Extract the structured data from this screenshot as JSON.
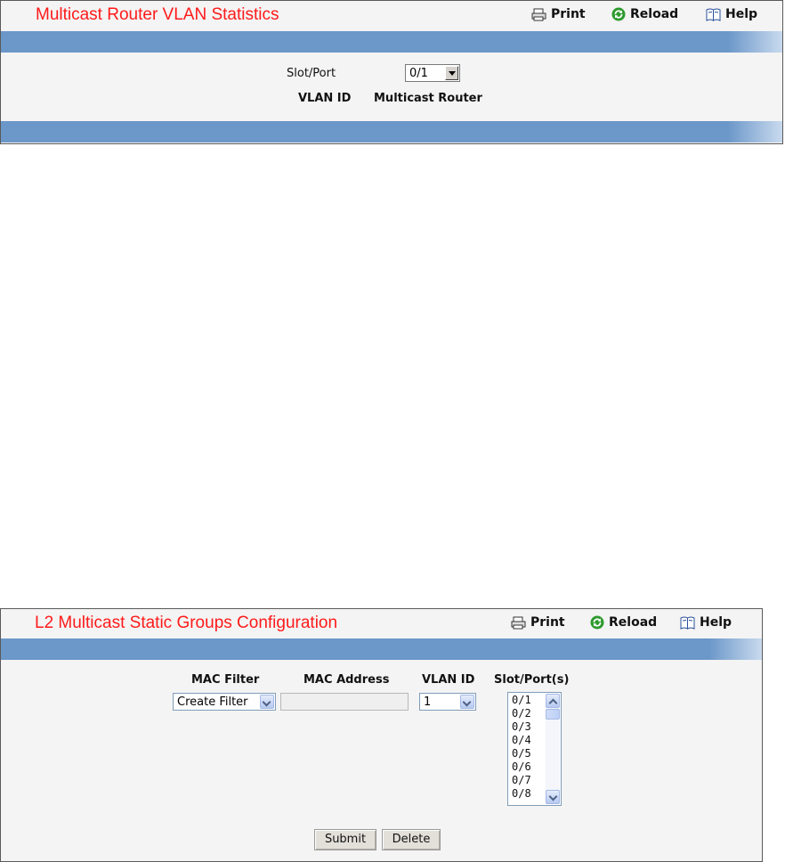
{
  "panel1": {
    "title": "Multicast Router VLAN Statistics",
    "toolbar": {
      "print_label": "Print",
      "reload_label": "Reload",
      "help_label": "Help"
    },
    "slot_port_label": "Slot/Port",
    "slot_port_value": "0/1",
    "columns": {
      "vlan_id": "VLAN ID",
      "multicast_router": "Multicast Router"
    }
  },
  "panel2": {
    "title": "L2 Multicast Static Groups Configuration",
    "toolbar": {
      "print_label": "Print",
      "reload_label": "Reload",
      "help_label": "Help"
    },
    "headers": {
      "mac_filter": "MAC Filter",
      "mac_address": "MAC Address",
      "vlan_id": "VLAN ID",
      "slot_ports": "Slot/Port(s)"
    },
    "mac_filter_value": "Create Filter",
    "mac_address_value": "",
    "vlan_id_value": "1",
    "slot_port_options": [
      "0/1",
      "0/2",
      "0/3",
      "0/4",
      "0/5",
      "0/6",
      "0/7",
      "0/8"
    ],
    "submit_label": "Submit",
    "delete_label": "Delete"
  },
  "colors": {
    "title_red": "#ff1a1a",
    "bar_blue": "#6b97c9",
    "panel_bg": "#f4f4f4"
  },
  "icons": {
    "print": "printer-icon",
    "reload": "reload-icon",
    "help": "help-book-icon"
  }
}
